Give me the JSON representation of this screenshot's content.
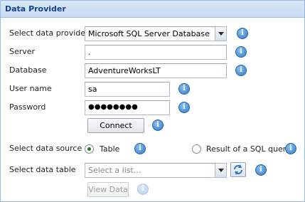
{
  "panel": {
    "title": "Data Provider"
  },
  "provider": {
    "label": "Select data provider",
    "value": "Microsoft SQL Server Database"
  },
  "server": {
    "label": "Server",
    "value": "."
  },
  "database": {
    "label": "Database",
    "value": "AdventureWorksLT"
  },
  "username": {
    "label": "User name",
    "value": "sa"
  },
  "password": {
    "label": "Password",
    "value": "●●●●●●●●"
  },
  "connect": {
    "label": "Connect"
  },
  "source": {
    "label": "Select data source",
    "options": [
      "Table",
      "Result of a SQL query"
    ],
    "selected": "Table"
  },
  "table": {
    "label": "Select data table",
    "placeholder": "Select a list..."
  },
  "view_data": {
    "label": "View Data"
  },
  "info_symbol": "i",
  "colors": {
    "header_text": "#15428b",
    "info_blue": "#2f78c8",
    "border": "#99bbe8"
  },
  "icons": {
    "info": "info-icon",
    "dropdown": "chevron-down-icon",
    "refresh": "refresh-icon"
  }
}
